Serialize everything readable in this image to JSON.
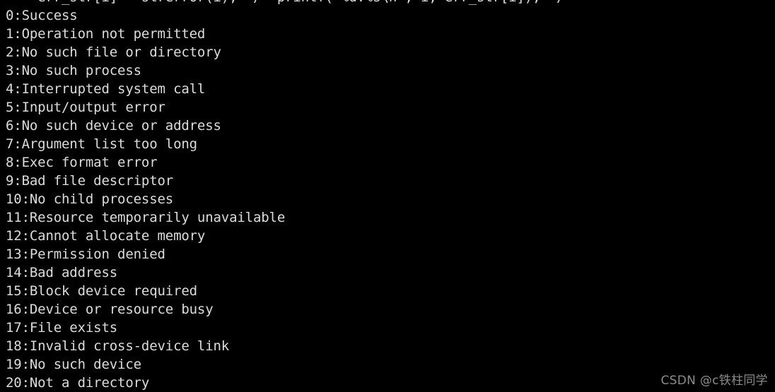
{
  "terminal": {
    "background_color": "#000000",
    "text_color": "#dcdcdc",
    "clipped_top_line": "    err_str[i] = strerror(i);  /* printf(\"%d:%s\\n\", i, err_str[i]); */",
    "lines": [
      "0:Success",
      "1:Operation not permitted",
      "2:No such file or directory",
      "3:No such process",
      "4:Interrupted system call",
      "5:Input/output error",
      "6:No such device or address",
      "7:Argument list too long",
      "8:Exec format error",
      "9:Bad file descriptor",
      "10:No child processes",
      "11:Resource temporarily unavailable",
      "12:Cannot allocate memory",
      "13:Permission denied",
      "14:Bad address",
      "15:Block device required",
      "16:Device or resource busy",
      "17:File exists",
      "18:Invalid cross-device link",
      "19:No such device",
      "20:Not a directory"
    ]
  },
  "watermark": {
    "text": "CSDN @c铁柱同学",
    "color": "#8c8c8c"
  }
}
